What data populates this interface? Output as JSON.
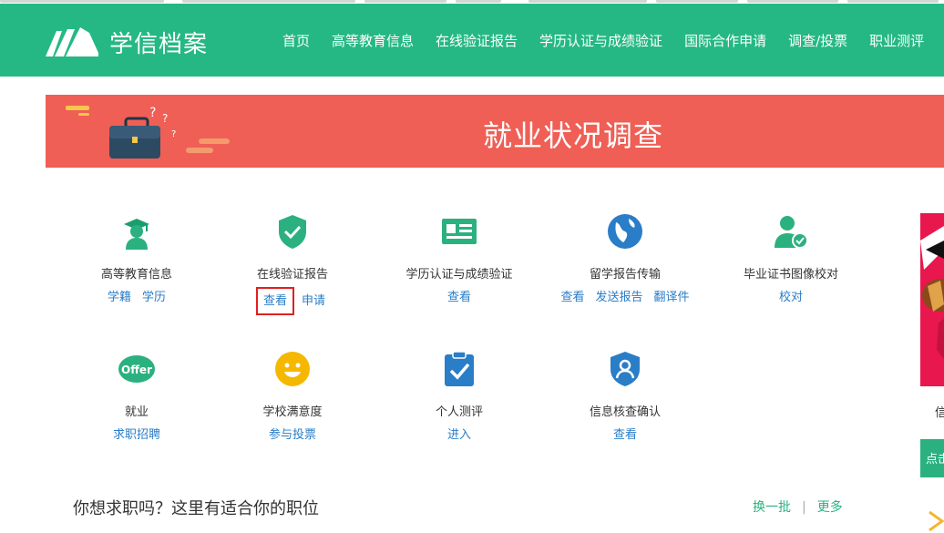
{
  "header": {
    "logo_text": "学信档案",
    "nav": [
      "首页",
      "高等教育信息",
      "在线验证报告",
      "学历认证与成绩验证",
      "国际合作申请",
      "调查/投票",
      "职业测评"
    ]
  },
  "banner": {
    "title": "就业状况调查"
  },
  "services": [
    {
      "icon": "graduate-icon",
      "name": "高等教育信息",
      "links": [
        "学籍",
        "学历"
      ]
    },
    {
      "icon": "shield-check-icon",
      "name": "在线验证报告",
      "links": [
        "查看",
        "申请"
      ]
    },
    {
      "icon": "id-card-icon",
      "name": "学历认证与成绩验证",
      "links": [
        "查看"
      ]
    },
    {
      "icon": "globe-icon",
      "name": "留学报告传输",
      "links": [
        "查看",
        "发送报告",
        "翻译件"
      ]
    },
    {
      "icon": "user-check-icon",
      "name": "毕业证书图像校对",
      "links": [
        "校对"
      ]
    },
    {
      "icon": "offer-icon",
      "icon_text": "Offer",
      "name": "就业",
      "links": [
        "求职招聘"
      ]
    },
    {
      "icon": "smiley-icon",
      "name": "学校满意度",
      "links": [
        "参与投票"
      ]
    },
    {
      "icon": "clipboard-check-icon",
      "name": "个人测评",
      "links": [
        "进入"
      ]
    },
    {
      "icon": "shield-user-icon",
      "name": "信息核查确认",
      "links": [
        "查看"
      ]
    }
  ],
  "jobs": {
    "title": "你想求职吗？这里有适合你的职位",
    "refresh": "换一批",
    "more": "更多"
  },
  "side": {
    "text": "信",
    "button": "点击"
  },
  "colors": {
    "brand": "#25b885",
    "banner": "#ef5f55",
    "link": "#2a7dc7",
    "highlight": "#e02020"
  }
}
